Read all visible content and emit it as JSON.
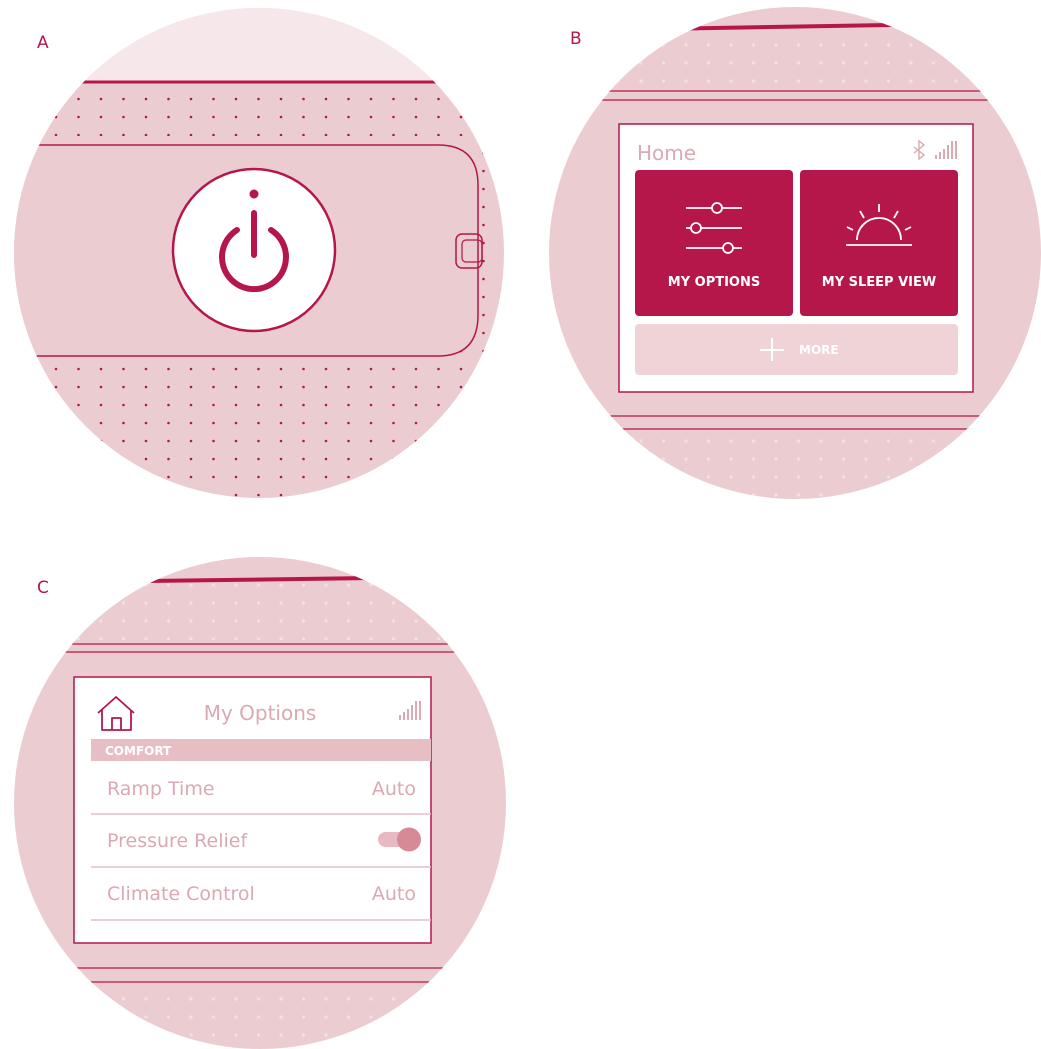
{
  "labels": {
    "a": "A",
    "b": "B",
    "c": "C"
  },
  "colors": {
    "brand": "#b5174a",
    "circle_fill": "#ebcdd1",
    "circle_top_light": "#f6e8ea",
    "muted_text": "#dba9b2",
    "screen_bg": "#ffffff",
    "header_band": "#e8bec5",
    "more_button": "#efd3d7",
    "toggle_knob": "#d68a96",
    "toggle_track": "#e9b9c1"
  },
  "panel_b": {
    "screen_title": "Home",
    "tile_options_label": "MY OPTIONS",
    "tile_sleep_label": "MY SLEEP VIEW",
    "more_label": "MORE",
    "icons": [
      "bluetooth-icon",
      "signal-icon",
      "sliders-icon",
      "sunrise-icon",
      "plus-icon"
    ]
  },
  "panel_c": {
    "screen_title": "My Options",
    "section": "COMFORT",
    "rows": [
      {
        "label": "Ramp Time",
        "value": "Auto"
      },
      {
        "label": "Pressure Relief",
        "value": "",
        "toggle": true
      },
      {
        "label": "Climate Control",
        "value": "Auto"
      }
    ],
    "icons": [
      "home-icon",
      "signal-icon"
    ]
  }
}
